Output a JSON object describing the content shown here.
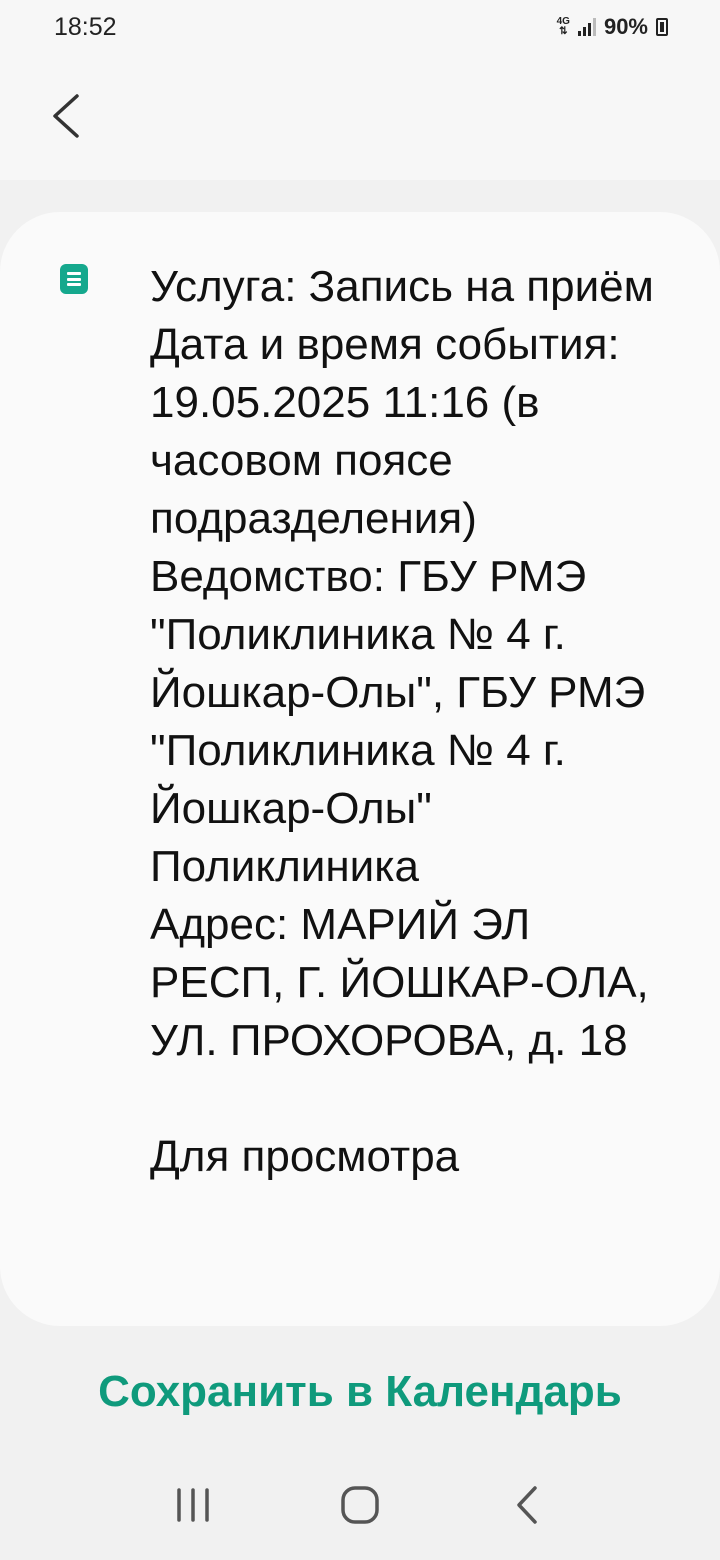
{
  "status_bar": {
    "time": "18:52",
    "network": "4G",
    "battery": "90%"
  },
  "message": {
    "text": "Услуга: Запись на приём\nДата и время события: 19.05.2025 11:16 (в часовом поясе подразделения)\nВедомство: ГБУ РМЭ \"Поликлиника № 4 г. Йошкар-Олы\", ГБУ РМЭ \"Поликлиника № 4 г. Йошкар-Олы\" Поликлиника\nАдрес: МАРИЙ ЭЛ РЕСП, Г. ЙОШКАР-ОЛА, УЛ. ПРОХОРОВА, д. 18\n\nДля просмотра"
  },
  "actions": {
    "save_calendar_label": "Сохранить в Календарь"
  },
  "icons": {
    "back": "back-arrow-icon",
    "message": "message-icon",
    "recents": "recents-icon",
    "home": "home-icon",
    "nav_back": "nav-back-icon"
  },
  "colors": {
    "accent": "#0f9a7c",
    "icon": "#15a88d"
  }
}
